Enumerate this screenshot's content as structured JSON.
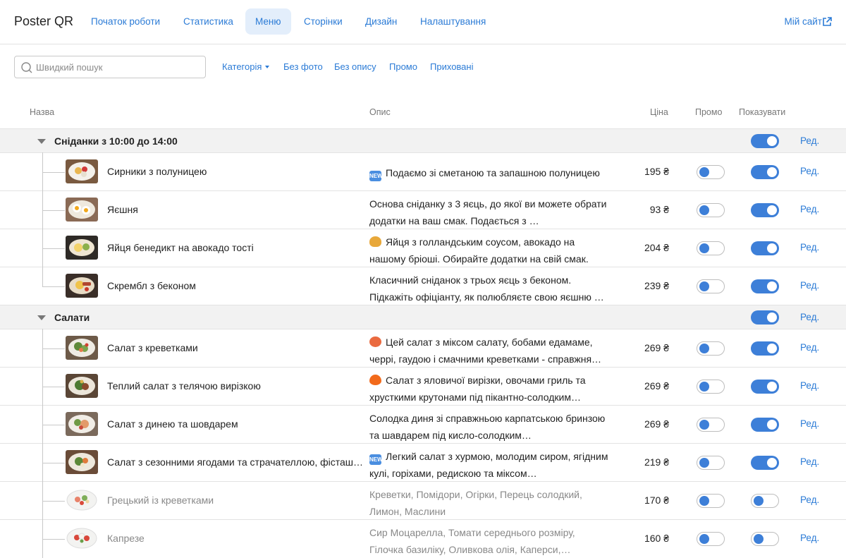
{
  "header": {
    "brand": "Poster QR",
    "nav": [
      "Початок роботи",
      "Статистика",
      "Меню",
      "Сторінки",
      "Дизайн",
      "Налаштування"
    ],
    "active_nav": "Меню",
    "my_site": "Мій сайт"
  },
  "filters": {
    "search_placeholder": "Швидкий пошук",
    "category": "Категорія",
    "no_photo": "Без фото",
    "no_description": "Без опису",
    "promo": "Промо",
    "hidden": "Приховані"
  },
  "columns": {
    "name": "Назва",
    "description": "Опис",
    "price": "Ціна",
    "promo": "Промо",
    "show": "Показувати"
  },
  "edit_label": "Ред.",
  "categories": [
    {
      "name": "Сніданки з 10:00 до 14:00",
      "show": true,
      "items": [
        {
          "name": "Сирники з полуницею",
          "emoji": "new-icon",
          "description": "Подаємо зі сметаною та запашною полуницею",
          "price": "195 ₴",
          "promo": false,
          "show": true
        },
        {
          "name": "Яєшня",
          "emoji": "",
          "description": "Основа сніданку з 3 яєць, до якої ви можете обрати додатки на ваш смак. Подається з …",
          "price": "93 ₴",
          "promo": false,
          "show": true
        },
        {
          "name": "Яйця бенедикт на авокадо тості",
          "emoji": "croissant-icon",
          "description": "Яйця з голландським соусом, авокадо на нашому бріоші. Обирайте додатки на свій смак.",
          "price": "204 ₴",
          "promo": false,
          "show": true
        },
        {
          "name": "Скрембл з беконом",
          "emoji": "",
          "description": "Класичний сніданок з трьох яєць з беконом. Підкажіть офіціанту, як полюбляєте свою яєшню …",
          "price": "239 ₴",
          "promo": false,
          "show": true
        }
      ]
    },
    {
      "name": "Салати",
      "show": true,
      "items": [
        {
          "name": "Салат з креветками",
          "emoji": "shrimp-icon",
          "description": "Цей салат з міксом салату, бобами едамаме, черрі, гаудою і смачними креветками - справжня…",
          "price": "269 ₴",
          "promo": false,
          "show": true
        },
        {
          "name": "Теплий салат з телячою вирізкою",
          "emoji": "fire-icon",
          "description": "Салат з яловичої вирізки, овочами гриль та хрусткими крутонами під пікантно-солодким…",
          "price": "269 ₴",
          "promo": false,
          "show": true
        },
        {
          "name": "Салат з динею та шовдарем",
          "emoji": "",
          "description": "Солодка диня зі справжньою карпатською бринзою та шавдарем під кисло-солодким…",
          "price": "269 ₴",
          "promo": false,
          "show": true
        },
        {
          "name": "Салат з сезонними ягодами та страчателлою, фісташ…",
          "emoji": "new-icon",
          "description": "Легкий салат з хурмою, молодим сиром, ягідним кулі, горіхами, редискою та міксом…",
          "price": "219 ₴",
          "promo": false,
          "show": true
        },
        {
          "name": "Грецький із креветками",
          "emoji": "",
          "description": "Креветки, Помідори, Огірки, Перець солодкий, Лимон, Маслини",
          "price": "170 ₴",
          "promo": false,
          "show": false
        },
        {
          "name": "Капрезе",
          "emoji": "",
          "description": "Сир Моцарелла, Томати середнього розміру, Гілочка базиліку, Оливкова олія, Каперси,…",
          "price": "160 ₴",
          "promo": false,
          "show": false
        }
      ]
    }
  ],
  "colors": {
    "accent": "#2b7bd6",
    "toggle_on": "#3d7fd8",
    "category_bg": "#f2f2f2",
    "active_nav_bg": "#e3eefb"
  }
}
